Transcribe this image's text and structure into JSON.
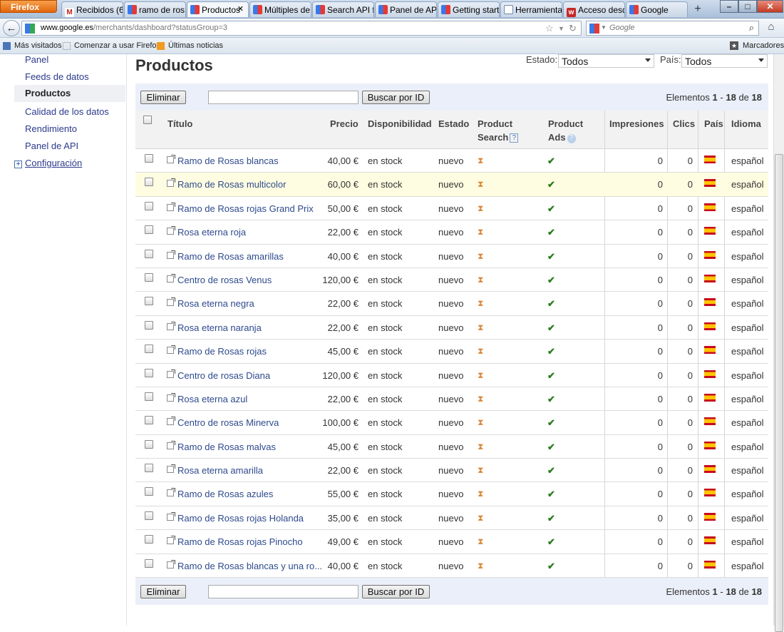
{
  "browser": {
    "app_button": "Firefox",
    "tabs": [
      {
        "label": "Recibidos (6...",
        "icon": "gmail-icon"
      },
      {
        "label": "ramo de ros...",
        "icon": "google-icon"
      },
      {
        "label": "Productos",
        "icon": "google-icon"
      },
      {
        "label": "Múltiples de...",
        "icon": "google-icon"
      },
      {
        "label": "Search API f...",
        "icon": "google-icon"
      },
      {
        "label": "Panel de API",
        "icon": "google-icon"
      },
      {
        "label": "Getting start...",
        "icon": "google-icon"
      },
      {
        "label": "Herramienta...",
        "icon": "document-icon"
      },
      {
        "label": "Acceso desd...",
        "icon": "web-icon"
      },
      {
        "label": "Google",
        "icon": "google-icon"
      }
    ],
    "url_host": "www.google.es",
    "url_path": "/merchants/dashboard?statusGroup=3",
    "search_placeholder": "Google",
    "bookmarks": [
      "Más visitados",
      "Comenzar a usar Firefox",
      "Últimas noticias"
    ],
    "bookmarks_menu": "Marcadores"
  },
  "sidebar": {
    "items": [
      "Panel",
      "Feeds de datos",
      "Productos",
      "Calidad de los datos",
      "Rendimiento",
      "Panel de API"
    ],
    "config": "Configuración"
  },
  "page": {
    "title": "Productos",
    "filter_estado_label": "Estado:",
    "filter_estado_value": "Todos",
    "filter_pais_label": "País:",
    "filter_pais_value": "Todos",
    "delete_label": "Eliminar",
    "search_id_label": "Buscar por ID",
    "count_prefix": "Elementos",
    "count_from": "1",
    "count_sep": "-",
    "count_to": "18",
    "count_of": "de",
    "count_total": "18"
  },
  "table": {
    "headers": {
      "title": "Título",
      "price": "Precio",
      "availability": "Disponibilidad",
      "status": "Estado",
      "product_search_1": "Product",
      "product_search_2": "Search",
      "product_ads_1": "Product",
      "product_ads_2": "Ads",
      "impressions": "Impresiones",
      "clicks": "Clics",
      "country": "País",
      "language": "Idioma"
    },
    "rows": [
      {
        "title": "Ramo de Rosas blancas",
        "price": "40,00 €",
        "availability": "en stock",
        "status": "nuevo",
        "impressions": "0",
        "clicks": "0",
        "language": "español"
      },
      {
        "title": "Ramo de Rosas multicolor",
        "price": "60,00 €",
        "availability": "en stock",
        "status": "nuevo",
        "impressions": "0",
        "clicks": "0",
        "language": "español"
      },
      {
        "title": "Ramo de Rosas rojas Grand Prix",
        "price": "50,00 €",
        "availability": "en stock",
        "status": "nuevo",
        "impressions": "0",
        "clicks": "0",
        "language": "español"
      },
      {
        "title": "Rosa eterna roja",
        "price": "22,00 €",
        "availability": "en stock",
        "status": "nuevo",
        "impressions": "0",
        "clicks": "0",
        "language": "español"
      },
      {
        "title": "Ramo de Rosas amarillas",
        "price": "40,00 €",
        "availability": "en stock",
        "status": "nuevo",
        "impressions": "0",
        "clicks": "0",
        "language": "español"
      },
      {
        "title": "Centro de rosas Venus",
        "price": "120,00 €",
        "availability": "en stock",
        "status": "nuevo",
        "impressions": "0",
        "clicks": "0",
        "language": "español"
      },
      {
        "title": "Rosa eterna negra",
        "price": "22,00 €",
        "availability": "en stock",
        "status": "nuevo",
        "impressions": "0",
        "clicks": "0",
        "language": "español"
      },
      {
        "title": "Rosa eterna naranja",
        "price": "22,00 €",
        "availability": "en stock",
        "status": "nuevo",
        "impressions": "0",
        "clicks": "0",
        "language": "español"
      },
      {
        "title": "Ramo de Rosas rojas",
        "price": "45,00 €",
        "availability": "en stock",
        "status": "nuevo",
        "impressions": "0",
        "clicks": "0",
        "language": "español"
      },
      {
        "title": "Centro de rosas Diana",
        "price": "120,00 €",
        "availability": "en stock",
        "status": "nuevo",
        "impressions": "0",
        "clicks": "0",
        "language": "español"
      },
      {
        "title": "Rosa eterna azul",
        "price": "22,00 €",
        "availability": "en stock",
        "status": "nuevo",
        "impressions": "0",
        "clicks": "0",
        "language": "español"
      },
      {
        "title": "Centro de rosas Minerva",
        "price": "100,00 €",
        "availability": "en stock",
        "status": "nuevo",
        "impressions": "0",
        "clicks": "0",
        "language": "español"
      },
      {
        "title": "Ramo de Rosas malvas",
        "price": "45,00 €",
        "availability": "en stock",
        "status": "nuevo",
        "impressions": "0",
        "clicks": "0",
        "language": "español"
      },
      {
        "title": "Rosa eterna amarilla",
        "price": "22,00 €",
        "availability": "en stock",
        "status": "nuevo",
        "impressions": "0",
        "clicks": "0",
        "language": "español"
      },
      {
        "title": "Ramo de Rosas azules",
        "price": "55,00 €",
        "availability": "en stock",
        "status": "nuevo",
        "impressions": "0",
        "clicks": "0",
        "language": "español"
      },
      {
        "title": "Ramo de Rosas rojas Holanda",
        "price": "35,00 €",
        "availability": "en stock",
        "status": "nuevo",
        "impressions": "0",
        "clicks": "0",
        "language": "español"
      },
      {
        "title": "Ramo de Rosas rojas Pinocho",
        "price": "49,00 €",
        "availability": "en stock",
        "status": "nuevo",
        "impressions": "0",
        "clicks": "0",
        "language": "español"
      },
      {
        "title": "Ramo de Rosas blancas y una ro...",
        "price": "40,00 €",
        "availability": "en stock",
        "status": "nuevo",
        "impressions": "0",
        "clicks": "0",
        "language": "español"
      }
    ]
  },
  "colors": {
    "link": "#2d4a8c",
    "action_bar": "#ebeff9",
    "highlight_row": "#fffde1",
    "check_green": "#2a7d1e",
    "pending_orange": "#d9893a"
  }
}
